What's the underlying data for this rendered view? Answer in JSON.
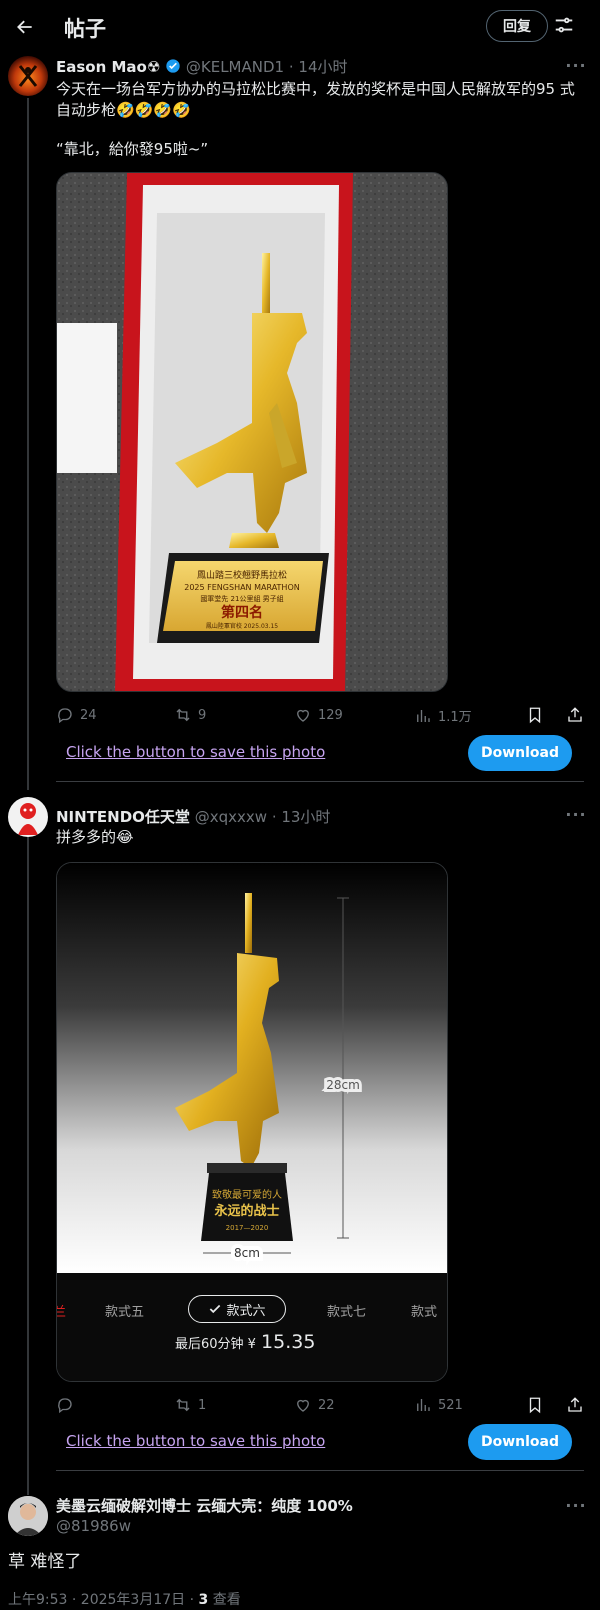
{
  "header": {
    "title": "帖子",
    "reply_label": "回复",
    "back_icon": "arrow-left-icon",
    "filter_icon": "sliders-icon"
  },
  "post1": {
    "name": "Eason Mao☢",
    "handle": "@KELMAND1",
    "time": "· 14小时",
    "text_line1": "今天在一场台军方协办的马拉松比赛中，发放的奖杯是中国人民解放军的95 式",
    "text_line2": "自动步枪🤣🤣🤣🤣",
    "quote": "“靠北，給你發95啦~”",
    "photo": {
      "plaque_line1": "鳳山踏三校翹野馬拉松",
      "plaque_line2": "2025 FENGSHAN MARATHON",
      "plaque_line3": "國軍堂先 21公里組 男子組",
      "plaque_rank": "第四名",
      "plaque_foot": "鳳山陸軍官校 2025.03.15"
    },
    "stats": {
      "replies": "24",
      "retweets": "9",
      "likes": "129",
      "views": "1.1万"
    },
    "save_text": "Click the button to save this photo",
    "download_label": "Download"
  },
  "post2": {
    "name": "NINTENDO任天堂",
    "handle": "@xqxxxw",
    "time": "· 13小时",
    "text": "拼多多的😂",
    "photo": {
      "height_label": "28cm",
      "width_label": "8cm",
      "base_line1": "致敬最可爱的人",
      "base_line2": "永远的战士",
      "base_line3": "2017—2020",
      "variants": [
        "兰",
        "款式五",
        "款式六",
        "款式七",
        "款式"
      ],
      "selected_variant": "款式六",
      "price_prefix": "最后60分钟 ¥",
      "price": "15.35"
    },
    "stats": {
      "replies": "",
      "retweets": "1",
      "likes": "22",
      "views": "521"
    },
    "save_text": "Click the button to save this photo",
    "download_label": "Download"
  },
  "post3": {
    "name": "美墨云缅破解刘博士 云缅大壳：纯度 100%",
    "handle": "@81986w",
    "text": "草 难怪了",
    "meta_time": "上午9:53 · 2025年3月17日 · ",
    "meta_views": "3",
    "meta_views_label": " 查看"
  },
  "colors": {
    "accent": "#1d9bf0",
    "link": "#c6a4f0",
    "muted": "#71767b",
    "verified": "#1d9bf0"
  }
}
